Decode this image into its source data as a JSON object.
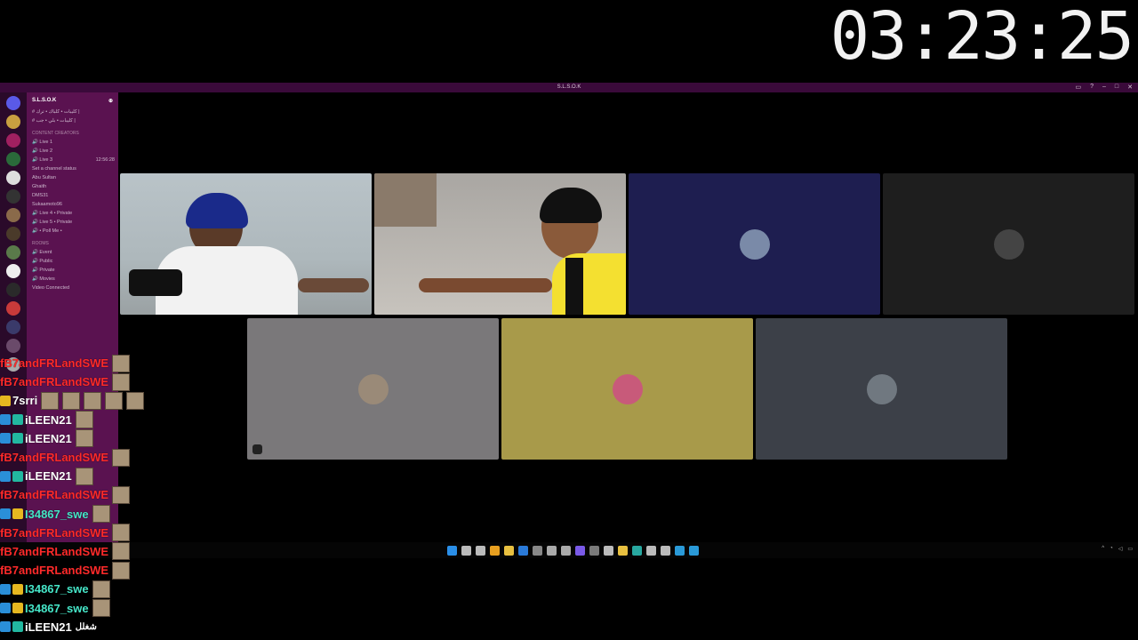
{
  "timer": "03:23:25",
  "window_title": "S.L.S.O.K",
  "server": {
    "name": "S.L.S.O.K"
  },
  "channels": [
    {
      "label": "كليبات • كلباك • ترك |",
      "type": "text"
    },
    {
      "label": "كليبات • بلي • جب |",
      "type": "text"
    },
    {
      "label": "CONTENT CREATORS",
      "type": "category"
    },
    {
      "label": "Live 1",
      "type": "voice"
    },
    {
      "label": "Live 2",
      "type": "voice"
    },
    {
      "label": "Live 3",
      "type": "voice",
      "time": "12:56:28"
    },
    {
      "label": "Set a channel status",
      "type": "status"
    },
    {
      "label": "Abu Sultan",
      "type": "user"
    },
    {
      "label": "Ghaith",
      "type": "user"
    },
    {
      "label": "DMS31",
      "type": "user"
    },
    {
      "label": "Sukaamoto96",
      "type": "user"
    },
    {
      "label": "Live 4 • Private",
      "type": "voice"
    },
    {
      "label": "Live 5 • Private",
      "type": "voice"
    },
    {
      "label": "• Poll Me •",
      "type": "voice"
    },
    {
      "label": "ROOMS",
      "type": "category"
    },
    {
      "label": "Event",
      "type": "voice"
    },
    {
      "label": "Public",
      "type": "voice"
    },
    {
      "label": "Private",
      "type": "voice"
    },
    {
      "label": "Movies",
      "type": "voice"
    },
    {
      "label": "Video Connected",
      "type": "status"
    }
  ],
  "tiles": [
    {
      "kind": "camera",
      "id": "cam1"
    },
    {
      "kind": "camera",
      "id": "cam2"
    },
    {
      "kind": "avatar",
      "bg": "#1e1e50",
      "avatar_color": "#7a8aa8"
    },
    {
      "kind": "avatar",
      "bg": "#1e1e1e",
      "avatar_color": "#444444"
    },
    {
      "kind": "avatar",
      "bg": "#7a787a",
      "avatar_color": "#9a8a78"
    },
    {
      "kind": "avatar",
      "bg": "#a89a4a",
      "avatar_color": "#c85a7a"
    },
    {
      "kind": "avatar",
      "bg": "#3c4048",
      "avatar_color": "#707880"
    }
  ],
  "chat": [
    {
      "user": "fB7andFRLandSWE",
      "color": "red",
      "badges": [],
      "emotes": 1
    },
    {
      "user": "fB7andFRLandSWE",
      "color": "red",
      "badges": [],
      "emotes": 1
    },
    {
      "user": "7srri",
      "color": "white",
      "badges": [
        "gold"
      ],
      "emotes": 5
    },
    {
      "user": "iLEEN21",
      "color": "white",
      "badges": [
        "blue",
        "teal"
      ],
      "emotes": 1
    },
    {
      "user": "iLEEN21",
      "color": "white",
      "badges": [
        "blue",
        "teal"
      ],
      "emotes": 1
    },
    {
      "user": "fB7andFRLandSWE",
      "color": "red",
      "badges": [],
      "emotes": 1
    },
    {
      "user": "iLEEN21",
      "color": "white",
      "badges": [
        "blue",
        "teal"
      ],
      "emotes": 1
    },
    {
      "user": "fB7andFRLandSWE",
      "color": "red",
      "badges": [],
      "emotes": 1
    },
    {
      "user": "I34867_swe",
      "color": "cyan",
      "badges": [
        "blue",
        "gold"
      ],
      "emotes": 1
    },
    {
      "user": "fB7andFRLandSWE",
      "color": "red",
      "badges": [],
      "emotes": 1
    },
    {
      "user": "fB7andFRLandSWE",
      "color": "red",
      "badges": [],
      "emotes": 1
    },
    {
      "user": "fB7andFRLandSWE",
      "color": "red",
      "badges": [],
      "emotes": 1
    },
    {
      "user": "I34867_swe",
      "color": "cyan",
      "badges": [
        "blue",
        "gold"
      ],
      "emotes": 1
    },
    {
      "user": "I34867_swe",
      "color": "cyan",
      "badges": [
        "blue",
        "gold"
      ],
      "emotes": 1
    },
    {
      "user": "iLEEN21",
      "color": "white",
      "badges": [
        "blue",
        "teal"
      ],
      "emotes": 0,
      "text": "شغلل"
    }
  ],
  "taskbar_icons": [
    "start-icon",
    "search-icon",
    "taskview-icon",
    "widgets-icon",
    "files-icon",
    "vscode-icon",
    "settings-icon",
    "app-icon",
    "app-icon",
    "discord-icon",
    "app-icon",
    "app-icon",
    "folder-icon",
    "browser-icon",
    "app-icon",
    "app-icon",
    "app-icon",
    "app-icon"
  ],
  "taskbar_icon_colors": [
    "#2a8fe8",
    "#bbbbbb",
    "#bbbbbb",
    "#e8a020",
    "#e8c040",
    "#2a7ad8",
    "#888888",
    "#aaaaaa",
    "#aaaaaa",
    "#7a5ae8",
    "#7a7a7a",
    "#bbbbbb",
    "#e8c040",
    "#28a8a0",
    "#bbbbbb",
    "#bbbbbb",
    "#2a9ad8",
    "#2a9ad8"
  ]
}
